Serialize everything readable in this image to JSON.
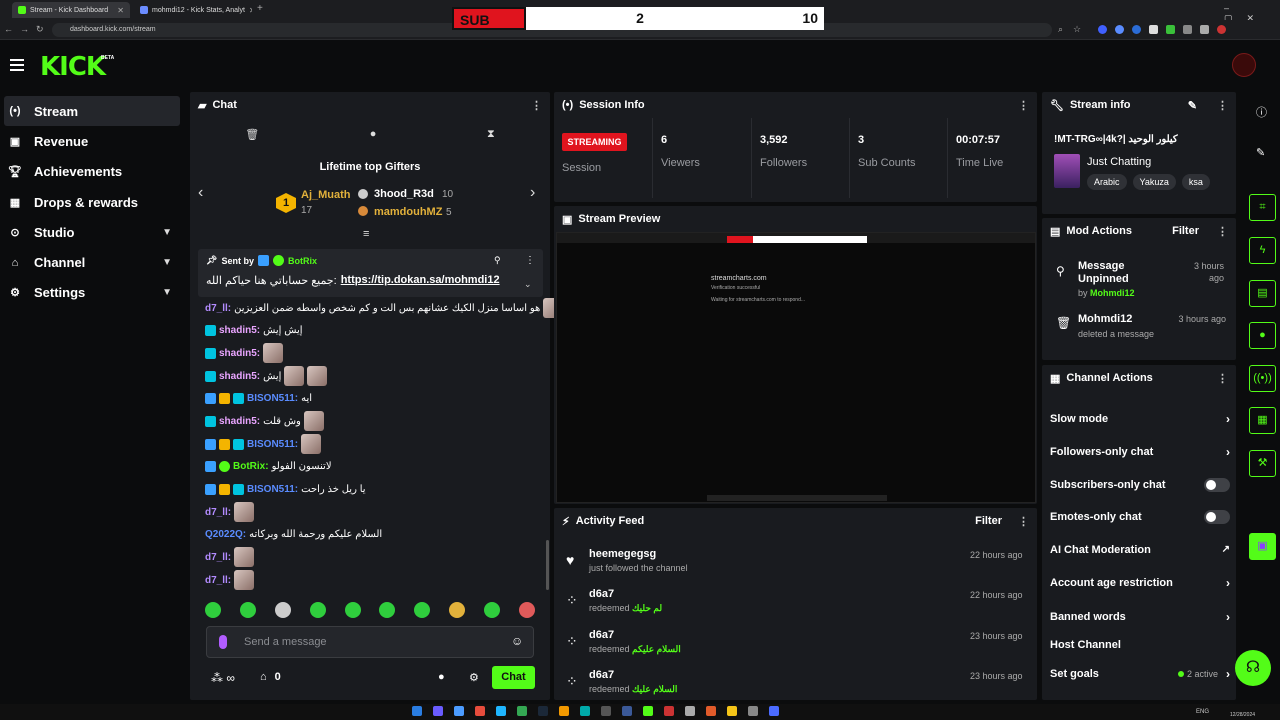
{
  "browser": {
    "tabs": [
      {
        "title": "Stream - Kick Dashboard"
      },
      {
        "title": "mohmdi12 - Kick Stats, Analyt"
      }
    ],
    "url": "dashboard.kick.com/stream"
  },
  "overlay": {
    "sub_label": "SUB",
    "left_score": "2",
    "right_score": "10"
  },
  "brand": {
    "logo": "KICK",
    "beta": "BETA",
    "accent": "#53fc18"
  },
  "sidebar": {
    "items": [
      {
        "label": "Stream",
        "icon": "broadcast-icon"
      },
      {
        "label": "Revenue",
        "icon": "money-icon"
      },
      {
        "label": "Achievements",
        "icon": "trophy-icon"
      },
      {
        "label": "Drops & rewards",
        "icon": "gift-icon"
      },
      {
        "label": "Studio",
        "icon": "studio-icon"
      },
      {
        "label": "Channel",
        "icon": "channel-icon"
      },
      {
        "label": "Settings",
        "icon": "gear-icon"
      }
    ]
  },
  "chat": {
    "title": "Chat",
    "gifters_title": "Lifetime top Gifters",
    "gifters": [
      {
        "rank": "1",
        "name": "Aj_Muath",
        "count": "17"
      },
      {
        "name": "3hood_R3d",
        "count": "10"
      },
      {
        "name": "mamdouhMZ",
        "count": "5"
      }
    ],
    "pinned": {
      "sent_by_label": "Sent by",
      "sender": "BotRix",
      "text": "جميع حساباتي هنا حياكم الله:",
      "link": "https://tip.dokan.sa/mohmdi12"
    },
    "messages": [
      {
        "user": "d7_ll:",
        "text": "هو اساسا منزل الكيك عشانهم بس الت و كم شخص واسطه ضمن العزيزين"
      },
      {
        "user": "shadin5:",
        "text": "إيش إيش"
      },
      {
        "user": "shadin5:",
        "text": ""
      },
      {
        "user": "shadin5:",
        "text": "إيش"
      },
      {
        "user": "BISON511:",
        "text": "ايه"
      },
      {
        "user": "shadin5:",
        "text": "وش قلت"
      },
      {
        "user": "BISON511:",
        "text": ""
      },
      {
        "user": "BotRix:",
        "text": "لاتنسون الفولو"
      },
      {
        "user": "BISON511:",
        "text": "يا ريل خذ راحت"
      },
      {
        "user": "d7_ll:",
        "text": ""
      },
      {
        "user": "Q2022Q:",
        "text": "السلام عليكم ورحمة الله وبركاته"
      },
      {
        "user": "d7_ll:",
        "text": ""
      },
      {
        "user": "d7_ll:",
        "text": ""
      }
    ],
    "input_placeholder": "Send a message",
    "send_label": "Chat",
    "viewer_count": "0"
  },
  "session": {
    "title": "Session Info",
    "status": "STREAMING",
    "status_label": "Session",
    "stats": [
      {
        "value": "6",
        "label": "Viewers"
      },
      {
        "value": "3,592",
        "label": "Followers"
      },
      {
        "value": "3",
        "label": "Sub Counts"
      },
      {
        "value": "00:07:57",
        "label": "Time Live"
      }
    ]
  },
  "preview": {
    "title": "Stream Preview",
    "inner_site": "streamcharts.com",
    "inner_sub": "Verification successful",
    "inner_wait": "Waiting for streamcharts.com to respond..."
  },
  "activity": {
    "title": "Activity Feed",
    "filter": "Filter",
    "items": [
      {
        "name": "heemegegsg",
        "desc": "just followed the channel",
        "reward": "",
        "time": "22 hours ago"
      },
      {
        "name": "d6a7",
        "desc": "redeemed",
        "reward": "لم حليك",
        "time": "22 hours ago"
      },
      {
        "name": "d6a7",
        "desc": "redeemed",
        "reward": "السلام عليكم",
        "time": "23 hours ago"
      },
      {
        "name": "d6a7",
        "desc": "redeemed",
        "reward": "السلام عليك",
        "time": "23 hours ago"
      }
    ]
  },
  "stream_info": {
    "title": "Stream info",
    "stream_title": "!MT-TRG∞|4k?| كيلور الوحيد",
    "category": "Just Chatting",
    "tags": [
      "Arabic",
      "Yakuza",
      "ksa"
    ]
  },
  "mod_actions": {
    "title": "Mod Actions",
    "filter": "Filter",
    "items": [
      {
        "action": "Message Unpinned",
        "by_label": "by",
        "by": "Mohmdi12",
        "time": "3 hours ago"
      },
      {
        "action": "Mohmdi12",
        "desc": "deleted a message",
        "time": "3 hours ago"
      }
    ]
  },
  "channel_actions": {
    "title": "Channel Actions",
    "items": [
      {
        "label": "Slow mode",
        "kind": "arrow"
      },
      {
        "label": "Followers-only chat",
        "kind": "arrow"
      },
      {
        "label": "Subscribers-only chat",
        "kind": "toggle"
      },
      {
        "label": "Emotes-only chat",
        "kind": "toggle"
      },
      {
        "label": "AI Chat Moderation",
        "kind": "external"
      },
      {
        "label": "Account age restriction",
        "kind": "arrow"
      },
      {
        "label": "Banned words",
        "kind": "arrow"
      },
      {
        "label": "Host Channel",
        "kind": "none"
      },
      {
        "label": "Set goals",
        "kind": "arrow",
        "extra": "2 active"
      }
    ]
  },
  "taskbar": {
    "lang": "ENG",
    "time": "",
    "date": "12/28/2024"
  }
}
